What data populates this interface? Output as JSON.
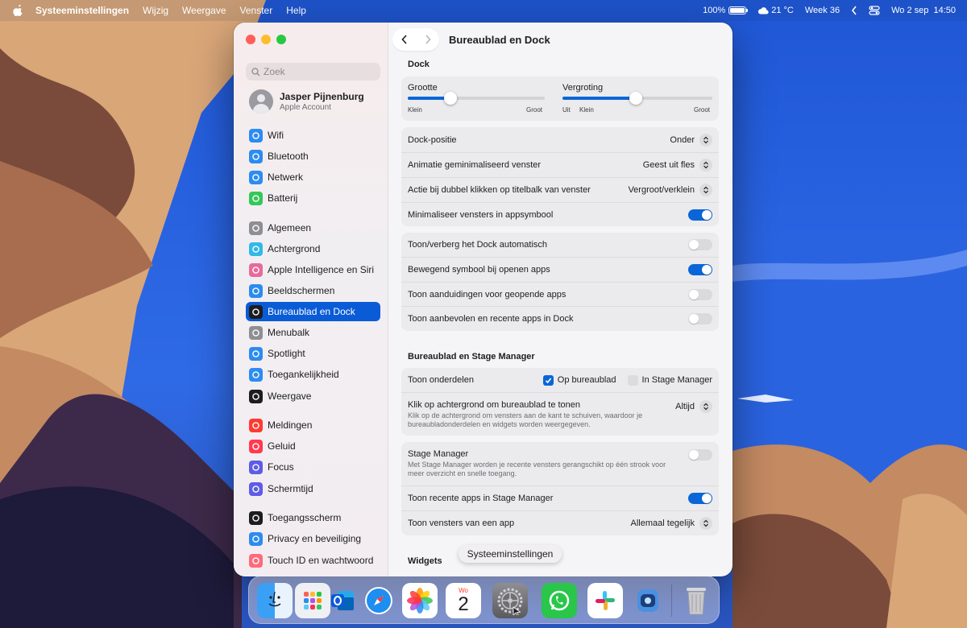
{
  "menubar": {
    "app_name": "Systeeminstellingen",
    "menus": [
      "Wijzig",
      "Weergave",
      "Venster",
      "Help"
    ],
    "battery": "100%",
    "weather": "21 °C",
    "week": "Week 36",
    "datetime": "Wo 2 sep  14:50"
  },
  "window": {
    "title": "Bureaublad en Dock"
  },
  "sidebar": {
    "search_placeholder": "Zoek",
    "account": {
      "name": "Jasper Pijnenburg",
      "sub": "Apple Account"
    },
    "items": [
      {
        "label": "Wifi",
        "icon": "wifi-icon",
        "color": "#2c8cf0"
      },
      {
        "label": "Bluetooth",
        "icon": "bluetooth-icon",
        "color": "#2c8cf0"
      },
      {
        "label": "Netwerk",
        "icon": "globe-icon",
        "color": "#2c8cf0"
      },
      {
        "label": "Batterij",
        "icon": "battery-icon",
        "color": "#34c759"
      },
      {
        "label": "Algemeen",
        "icon": "gear-icon",
        "color": "#8e8e93"
      },
      {
        "label": "Achtergrond",
        "icon": "wallpaper-icon",
        "color": "#31b8e8"
      },
      {
        "label": "Apple Intelligence en Siri",
        "icon": "siri-icon",
        "color": "#e86a9a"
      },
      {
        "label": "Beeldschermen",
        "icon": "brightness-icon",
        "color": "#2c8cf0"
      },
      {
        "label": "Bureaublad en Dock",
        "icon": "dock-icon",
        "color": "#1d1d1f"
      },
      {
        "label": "Menubalk",
        "icon": "menubar-icon",
        "color": "#8e8e93"
      },
      {
        "label": "Spotlight",
        "icon": "spotlight-icon",
        "color": "#2c8cf0"
      },
      {
        "label": "Toegankelijkheid",
        "icon": "accessibility-icon",
        "color": "#2c8cf0"
      },
      {
        "label": "Weergave",
        "icon": "appearance-icon",
        "color": "#1d1d1f"
      },
      {
        "label": "Meldingen",
        "icon": "notifications-icon",
        "color": "#ff3b30"
      },
      {
        "label": "Geluid",
        "icon": "sound-icon",
        "color": "#ff3b50"
      },
      {
        "label": "Focus",
        "icon": "moon-icon",
        "color": "#5e5ce6"
      },
      {
        "label": "Schermtijd",
        "icon": "hourglass-icon",
        "color": "#5e5ce6"
      },
      {
        "label": "Toegangsscherm",
        "icon": "lock-icon",
        "color": "#1d1d1f"
      },
      {
        "label": "Privacy en beveiliging",
        "icon": "hand-icon",
        "color": "#2c8cf0"
      },
      {
        "label": "Touch ID en wachtwoord",
        "icon": "fingerprint-icon",
        "color": "#ff6b7a"
      }
    ],
    "active_index": 8
  },
  "dock_section": {
    "header": "Dock",
    "size_slider": {
      "label": "Grootte",
      "min": "Klein",
      "max": "Groot",
      "value": 0.31
    },
    "magnify_slider": {
      "label": "Vergroting",
      "off": "Uit",
      "min": "Klein",
      "max": "Groot",
      "value": 0.49
    },
    "position": {
      "label": "Dock-positie",
      "value": "Onder"
    },
    "animation": {
      "label": "Animatie geminimaliseerd venster",
      "value": "Geest uit fles"
    },
    "double_click": {
      "label": "Actie bij dubbel klikken op titelbalk van venster",
      "value": "Vergroot/verklein"
    },
    "minimize_into_app": {
      "label": "Minimaliseer vensters in appsymbool",
      "on": true
    },
    "autohide": {
      "label": "Toon/verberg het Dock automatisch",
      "on": false
    },
    "animate_open": {
      "label": "Bewegend symbool bij openen apps",
      "on": true
    },
    "indicators": {
      "label": "Toon aanduidingen voor geopende apps",
      "on": false
    },
    "recent_apps": {
      "label": "Toon aanbevolen en recente apps in Dock",
      "on": false
    }
  },
  "stage_section": {
    "header": "Bureaublad en Stage Manager",
    "show_items": {
      "label": "Toon onderdelen",
      "opt1": "Op bureaublad",
      "opt1_on": true,
      "opt2": "In Stage Manager",
      "opt2_on": false
    },
    "click_wallpaper": {
      "label": "Klik op achtergrond om bureaublad te tonen",
      "desc": "Klik op de achtergrond om vensters aan de kant te schuiven, waardoor je bureaubladonderdelen en widgets worden weergegeven.",
      "value": "Altijd"
    },
    "stage_manager": {
      "label": "Stage Manager",
      "desc": "Met Stage Manager worden je recente vensters gerangschikt op één strook voor meer overzicht en snelle toegang.",
      "on": false
    },
    "recent_apps_stage": {
      "label": "Toon recente apps in Stage Manager",
      "on": true
    },
    "windows_of_app": {
      "label": "Toon vensters van een app",
      "value": "Allemaal tegelijk"
    }
  },
  "widgets_section": {
    "header": "Widgets"
  },
  "tooltip": "Systeeminstellingen",
  "dock": {
    "apps": [
      "finder-icon",
      "launchpad-icon",
      "outlook-icon",
      "safari-icon",
      "photos-icon",
      "calendar-icon",
      "system-settings-icon",
      "whatsapp-icon",
      "slack-icon",
      "proxyman-icon",
      "trash-icon"
    ],
    "calendar_day": "Wo",
    "calendar_date": "2"
  }
}
